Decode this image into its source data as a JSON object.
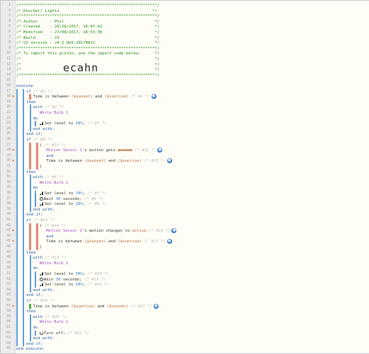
{
  "graffiti": "ecahn",
  "colors": {
    "comment": "#1d8a1d",
    "keyword": "#1f5bb5",
    "device": "#a545c9",
    "variable": "#b6612e",
    "number": "#2c7ad6",
    "bar_red": "#e8857a",
    "bar_green": "#4cae4c",
    "bar_blue": "#5b9be0",
    "trace_orange": "#e57a2a"
  },
  "lines": [
    {
      "n": "1",
      "parts": [
        {
          "t": "/**********************************************************/",
          "c": "comment"
        }
      ]
    },
    {
      "n": "2",
      "parts": [
        {
          "t": "/* Doorbell Lights                                       */",
          "c": "comment"
        }
      ]
    },
    {
      "n": "3",
      "parts": [
        {
          "t": "/**********************************************************/",
          "c": "comment"
        }
      ]
    },
    {
      "n": "4",
      "parts": [
        {
          "t": "/* Author     : Phil                                      */",
          "c": "comment"
        }
      ]
    },
    {
      "n": "5",
      "parts": [
        {
          "t": "/* Created    : 26/28/2017, 16:47:42                      */",
          "c": "comment"
        }
      ]
    },
    {
      "n": "6",
      "parts": [
        {
          "t": "/* Modified   : 27/08/2017, 18:53:36                      */",
          "c": "comment"
        }
      ]
    },
    {
      "n": "7",
      "parts": [
        {
          "t": "/* Build      : 23                                        */",
          "c": "comment"
        }
      ]
    },
    {
      "n": "8",
      "parts": [
        {
          "t": "/* UI version : v0.2.0e5.20170812                         */",
          "c": "comment"
        }
      ]
    },
    {
      "n": "9",
      "parts": [
        {
          "t": "/**********************************************************/",
          "c": "comment"
        }
      ]
    },
    {
      "n": "10",
      "parts": [
        {
          "t": "/* To import this piston, use the import code below:      */",
          "c": "comment"
        }
      ]
    },
    {
      "n": "11",
      "parts": [
        {
          "t": "/*                                                        */",
          "c": "comment"
        }
      ]
    },
    {
      "n": "12",
      "parts": [
        {
          "t": "/*                                                        */",
          "c": "comment"
        }
      ]
    },
    {
      "n": "13",
      "parts": [
        {
          "t": "/*                                                        */",
          "c": "comment"
        }
      ]
    },
    {
      "n": "14",
      "parts": [
        {
          "t": "/**********************************************************/",
          "c": "comment"
        }
      ]
    },
    {
      "n": "15",
      "parts": []
    },
    {
      "n": "16",
      "parts": [
        {
          "t": "execute",
          "c": "kw"
        }
      ]
    },
    {
      "n": "17",
      "ind": 3,
      "parts": [
        {
          "t": "if ",
          "c": "kw"
        },
        {
          "t": "/* #1 */",
          "c": "dim"
        }
      ]
    },
    {
      "n": "18",
      "ind": 5,
      "trace": "⚑",
      "parts": [
        {
          "t": "Time is between ",
          "c": "plain"
        },
        {
          "t": "($sunset)",
          "c": "var"
        },
        {
          "t": " and ",
          "c": "plain"
        },
        {
          "t": "($sunrise)",
          "c": "var"
        },
        {
          "t": " /* #4 */",
          "c": "dim"
        },
        {
          "i": "info"
        }
      ]
    },
    {
      "n": "19",
      "ind": 3,
      "parts": [
        {
          "t": "then",
          "c": "kw"
        }
      ]
    },
    {
      "n": "20",
      "ind": 5,
      "parts": [
        {
          "t": "with ",
          "c": "kw"
        },
        {
          "t": "/* #2 */",
          "c": "dim"
        }
      ]
    },
    {
      "n": "21",
      "ind": 7,
      "parts": [
        {
          "t": "White Bulb 1",
          "c": "dev"
        }
      ]
    },
    {
      "n": "22",
      "ind": 5,
      "parts": [
        {
          "t": "do",
          "c": "kw"
        }
      ]
    },
    {
      "n": "23",
      "ind": 7,
      "parts": [
        {
          "i": "bars"
        },
        {
          "t": "Set level to ",
          "c": "plain"
        },
        {
          "t": "20%",
          "c": "num"
        },
        {
          "t": "; ",
          "c": "plain"
        },
        {
          "t": "/* #3 */",
          "c": "dim"
        }
      ]
    },
    {
      "n": "24",
      "ind": 5,
      "parts": [
        {
          "t": "end with;",
          "c": "kw"
        }
      ]
    },
    {
      "n": "25",
      "ind": 3,
      "parts": [
        {
          "t": "end if;",
          "c": "kw"
        }
      ]
    },
    {
      "n": "26",
      "ind": 3,
      "parts": [
        {
          "t": "if ",
          "c": "kw"
        },
        {
          "t": "/* #5 */",
          "c": "dim"
        }
      ]
    },
    {
      "n": "27",
      "ind": 7,
      "parts": [
        {
          "t": "( ",
          "c": "plain"
        },
        {
          "t": "/* #23 */",
          "c": "dim"
        }
      ]
    },
    {
      "n": "28",
      "ind": 9,
      "trace": "⚑",
      "parts": [
        {
          "t": "Motion Sensor 1",
          "c": "dev"
        },
        {
          "t": "'s ",
          "c": "plain"
        },
        {
          "t": "button",
          "c": "plain italic"
        },
        {
          "t": " gets ",
          "c": "plain"
        },
        {
          "t": "pushed",
          "c": "var strike"
        },
        {
          "t": " /* #11 */",
          "c": "dim"
        },
        {
          "i": "info"
        }
      ]
    },
    {
      "n": "29",
      "ind": 9,
      "parts": [
        {
          "t": "and",
          "c": "kw"
        }
      ]
    },
    {
      "n": "30",
      "ind": 9,
      "trace": "⚑",
      "parts": [
        {
          "t": "Time is between ",
          "c": "plain"
        },
        {
          "t": "($sunset)",
          "c": "var"
        },
        {
          "t": " and ",
          "c": "plain"
        },
        {
          "t": "($sunrise)",
          "c": "var"
        },
        {
          "t": " /* #10 */",
          "c": "dim"
        },
        {
          "i": "info"
        }
      ]
    },
    {
      "n": "31",
      "ind": 7,
      "parts": [
        {
          "t": ")",
          "c": "plain"
        }
      ]
    },
    {
      "n": "32",
      "ind": 3,
      "parts": [
        {
          "t": "then",
          "c": "kw"
        }
      ]
    },
    {
      "n": "33",
      "ind": 5,
      "parts": [
        {
          "t": "with ",
          "c": "kw"
        },
        {
          "t": "/* #6 */",
          "c": "dim"
        }
      ]
    },
    {
      "n": "34",
      "ind": 7,
      "parts": [
        {
          "t": "White Bulb 1",
          "c": "dev"
        }
      ]
    },
    {
      "n": "35",
      "ind": 5,
      "parts": [
        {
          "t": "do",
          "c": "kw"
        }
      ]
    },
    {
      "n": "36",
      "ind": 7,
      "parts": [
        {
          "i": "bars"
        },
        {
          "t": "Set level to ",
          "c": "plain"
        },
        {
          "t": "70%",
          "c": "num"
        },
        {
          "t": "; ",
          "c": "plain"
        },
        {
          "t": "/* #7 */",
          "c": "dim"
        }
      ]
    },
    {
      "n": "37",
      "ind": 7,
      "parts": [
        {
          "i": "clock"
        },
        {
          "t": "Wait ",
          "c": "plain"
        },
        {
          "t": "30",
          "c": "num"
        },
        {
          "t": " seconds; ",
          "c": "plain"
        },
        {
          "t": "/* #8 */",
          "c": "dim"
        }
      ]
    },
    {
      "n": "38",
      "ind": 7,
      "parts": [
        {
          "i": "bars"
        },
        {
          "t": "Set level to ",
          "c": "plain"
        },
        {
          "t": "20%",
          "c": "num"
        },
        {
          "t": "; ",
          "c": "plain"
        },
        {
          "t": "/* #9 */",
          "c": "dim"
        }
      ]
    },
    {
      "n": "39",
      "ind": 5,
      "parts": [
        {
          "t": "end with;",
          "c": "kw"
        }
      ]
    },
    {
      "n": "40",
      "ind": 3,
      "parts": [
        {
          "t": "end if;",
          "c": "kw"
        }
      ]
    },
    {
      "n": "41",
      "ind": 3,
      "parts": [
        {
          "t": "if ",
          "c": "kw"
        },
        {
          "t": "/* #13 */",
          "c": "dim"
        }
      ]
    },
    {
      "n": "42",
      "ind": 7,
      "parts": [
        {
          "t": "( ",
          "c": "plain"
        },
        {
          "t": "/* #24 */",
          "c": "dim"
        }
      ]
    },
    {
      "n": "43",
      "ind": 9,
      "trace": "⚑",
      "parts": [
        {
          "t": "Motion Sensor 1",
          "c": "dev"
        },
        {
          "t": "'s ",
          "c": "plain"
        },
        {
          "t": "motion",
          "c": "plain italic"
        },
        {
          "t": " changes to ",
          "c": "plain"
        },
        {
          "t": "active",
          "c": "var"
        },
        {
          "t": " /* #18 */",
          "c": "dim"
        },
        {
          "i": "info"
        }
      ]
    },
    {
      "n": "44",
      "ind": 9,
      "parts": [
        {
          "t": "and",
          "c": "kw"
        }
      ]
    },
    {
      "n": "45",
      "ind": 9,
      "trace": "⚑",
      "parts": [
        {
          "t": "Time is between ",
          "c": "plain"
        },
        {
          "t": "($sunset)",
          "c": "var"
        },
        {
          "t": " and ",
          "c": "plain"
        },
        {
          "t": "($sunrise)",
          "c": "var"
        },
        {
          "t": " /* #17 */",
          "c": "dim"
        },
        {
          "i": "info"
        }
      ]
    },
    {
      "n": "46",
      "ind": 7,
      "parts": [
        {
          "t": ")",
          "c": "plain"
        }
      ]
    },
    {
      "n": "47",
      "ind": 3,
      "parts": [
        {
          "t": "then",
          "c": "kw"
        }
      ]
    },
    {
      "n": "48",
      "ind": 5,
      "parts": [
        {
          "t": "with ",
          "c": "kw"
        },
        {
          "t": "/* #13 */",
          "c": "dim"
        }
      ]
    },
    {
      "n": "49",
      "ind": 7,
      "parts": [
        {
          "t": "White Bulb 1",
          "c": "dev"
        }
      ]
    },
    {
      "n": "50",
      "ind": 5,
      "parts": [
        {
          "t": "do",
          "c": "kw"
        }
      ]
    },
    {
      "n": "51",
      "ind": 7,
      "parts": [
        {
          "i": "bars"
        },
        {
          "t": "Set level to ",
          "c": "plain"
        },
        {
          "t": "50%",
          "c": "num"
        },
        {
          "t": "; ",
          "c": "plain"
        },
        {
          "t": "/* #14 */",
          "c": "dim"
        }
      ]
    },
    {
      "n": "52",
      "ind": 7,
      "parts": [
        {
          "i": "clock"
        },
        {
          "t": "Wait ",
          "c": "plain"
        },
        {
          "t": "30",
          "c": "num"
        },
        {
          "t": " seconds; ",
          "c": "plain"
        },
        {
          "t": "/* #15 */",
          "c": "dim"
        }
      ]
    },
    {
      "n": "53",
      "ind": 7,
      "parts": [
        {
          "i": "bars"
        },
        {
          "t": "Set level to ",
          "c": "plain"
        },
        {
          "t": "20%",
          "c": "num"
        },
        {
          "t": "; ",
          "c": "plain"
        },
        {
          "t": "/* #16 */",
          "c": "dim"
        }
      ]
    },
    {
      "n": "54",
      "ind": 5,
      "parts": [
        {
          "t": "end with;",
          "c": "kw"
        }
      ]
    },
    {
      "n": "55",
      "ind": 3,
      "parts": [
        {
          "t": "end if;",
          "c": "kw"
        }
      ]
    },
    {
      "n": "56",
      "ind": 3,
      "parts": [
        {
          "t": "if ",
          "c": "kw"
        },
        {
          "t": "/* #19 */",
          "c": "dim"
        }
      ]
    },
    {
      "n": "57",
      "ind": 5,
      "trace": "⚑",
      "parts": [
        {
          "t": "Time is between ",
          "c": "plain"
        },
        {
          "t": "($sunrise)",
          "c": "var"
        },
        {
          "t": " and ",
          "c": "plain"
        },
        {
          "t": "($sunset)",
          "c": "var"
        },
        {
          "t": " /* #22 */",
          "c": "dim"
        },
        {
          "i": "info"
        }
      ]
    },
    {
      "n": "58",
      "ind": 3,
      "parts": [
        {
          "t": "then",
          "c": "kw"
        }
      ]
    },
    {
      "n": "59",
      "ind": 5,
      "parts": [
        {
          "t": "with ",
          "c": "kw"
        },
        {
          "t": "/* #20 */",
          "c": "dim"
        }
      ]
    },
    {
      "n": "60",
      "ind": 7,
      "parts": [
        {
          "t": "White Bulb 1",
          "c": "dev"
        }
      ]
    },
    {
      "n": "61",
      "ind": 5,
      "parts": [
        {
          "t": "do",
          "c": "kw"
        }
      ]
    },
    {
      "n": "62",
      "ind": 7,
      "parts": [
        {
          "i": "power"
        },
        {
          "t": "Turn off; ",
          "c": "plain"
        },
        {
          "t": "/* #21 */",
          "c": "dim"
        }
      ]
    },
    {
      "n": "63",
      "ind": 5,
      "parts": [
        {
          "t": "end with;",
          "c": "kw"
        }
      ]
    },
    {
      "n": "64",
      "ind": 3,
      "parts": [
        {
          "t": "end if;",
          "c": "kw"
        }
      ]
    },
    {
      "n": "65",
      "parts": [
        {
          "t": "end execute;",
          "c": "kw"
        }
      ]
    }
  ]
}
